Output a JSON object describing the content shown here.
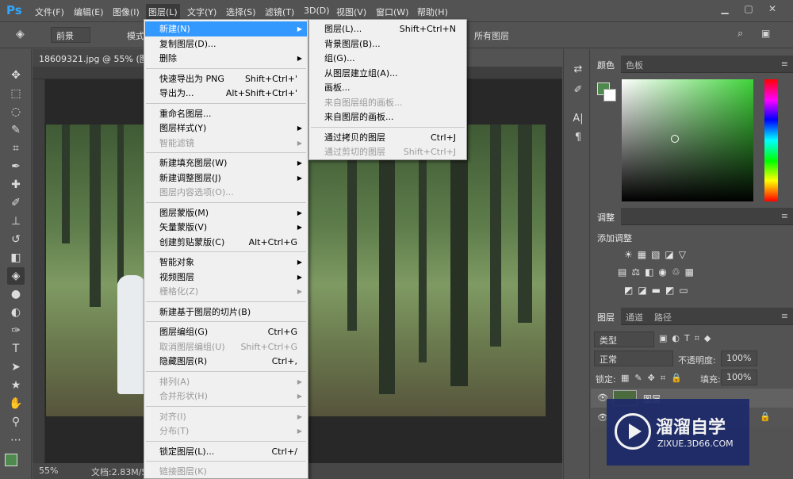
{
  "app": {
    "logo": "Ps"
  },
  "menubar": [
    "文件(F)",
    "编辑(E)",
    "图像(I)",
    "图层(L)",
    "文字(Y)",
    "选择(S)",
    "滤镜(T)",
    "3D(D)",
    "视图(V)",
    "窗口(W)",
    "帮助(H)"
  ],
  "options": {
    "preset": "前景",
    "mode_label": "模式",
    "sample": "所有图层"
  },
  "document": {
    "tab": "18609321.jpg @ 55% (图层",
    "zoom": "55%",
    "docsize": "文档:2.83M/5..."
  },
  "layer_menu": {
    "items": [
      {
        "label": "新建(N)",
        "sub": true,
        "hl": true
      },
      {
        "label": "复制图层(D)..."
      },
      {
        "label": "删除",
        "sub": true
      },
      {
        "sep": true
      },
      {
        "label": "快速导出为 PNG",
        "sc": "Shift+Ctrl+'"
      },
      {
        "label": "导出为...",
        "sc": "Alt+Shift+Ctrl+'"
      },
      {
        "sep": true
      },
      {
        "label": "重命名图层..."
      },
      {
        "label": "图层样式(Y)",
        "sub": true
      },
      {
        "label": "智能滤镜",
        "sub": true,
        "dis": true
      },
      {
        "sep": true
      },
      {
        "label": "新建填充图层(W)",
        "sub": true
      },
      {
        "label": "新建调整图层(J)",
        "sub": true
      },
      {
        "label": "图层内容选项(O)...",
        "dis": true
      },
      {
        "sep": true
      },
      {
        "label": "图层蒙版(M)",
        "sub": true
      },
      {
        "label": "矢量蒙版(V)",
        "sub": true
      },
      {
        "label": "创建剪贴蒙版(C)",
        "sc": "Alt+Ctrl+G"
      },
      {
        "sep": true
      },
      {
        "label": "智能对象",
        "sub": true
      },
      {
        "label": "视频图层",
        "sub": true
      },
      {
        "label": "栅格化(Z)",
        "sub": true,
        "dis": true
      },
      {
        "sep": true
      },
      {
        "label": "新建基于图层的切片(B)"
      },
      {
        "sep": true
      },
      {
        "label": "图层编组(G)",
        "sc": "Ctrl+G"
      },
      {
        "label": "取消图层编组(U)",
        "sc": "Shift+Ctrl+G",
        "dis": true
      },
      {
        "label": "隐藏图层(R)",
        "sc": "Ctrl+,"
      },
      {
        "sep": true
      },
      {
        "label": "排列(A)",
        "sub": true,
        "dis": true
      },
      {
        "label": "合并形状(H)",
        "sub": true,
        "dis": true
      },
      {
        "sep": true
      },
      {
        "label": "对齐(I)",
        "sub": true,
        "dis": true
      },
      {
        "label": "分布(T)",
        "sub": true,
        "dis": true
      },
      {
        "sep": true
      },
      {
        "label": "锁定图层(L)...",
        "sc": "Ctrl+/"
      },
      {
        "sep": true
      },
      {
        "label": "链接图层(K)",
        "dis": true
      }
    ]
  },
  "new_submenu": {
    "items": [
      {
        "label": "图层(L)...",
        "sc": "Shift+Ctrl+N"
      },
      {
        "label": "背景图层(B)..."
      },
      {
        "label": "组(G)..."
      },
      {
        "label": "从图层建立组(A)..."
      },
      {
        "label": "画板..."
      },
      {
        "label": "来自图层组的画板...",
        "dis": true
      },
      {
        "label": "来自图层的画板..."
      },
      {
        "sep": true
      },
      {
        "label": "通过拷贝的图层",
        "sc": "Ctrl+J"
      },
      {
        "label": "通过剪切的图层",
        "sc": "Shift+Ctrl+J",
        "dis": true
      }
    ]
  },
  "color_panel": {
    "tabs": [
      "颜色",
      "色板"
    ],
    "fg": "#4e8a4e",
    "bg": "#ffffff"
  },
  "adjust_panel": {
    "tab": "调整",
    "title": "添加调整"
  },
  "layers_panel": {
    "tabs": [
      "图层",
      "通道",
      "路径"
    ],
    "kind": "类型",
    "blend": "正常",
    "opacity_label": "不透明度:",
    "opacity": "100%",
    "lock_label": "锁定:",
    "fill_label": "填充:",
    "fill": "100%",
    "layer_name": "图层"
  },
  "watermark": {
    "title": "溜溜自学",
    "url": "ZIXUE.3D66.COM"
  }
}
